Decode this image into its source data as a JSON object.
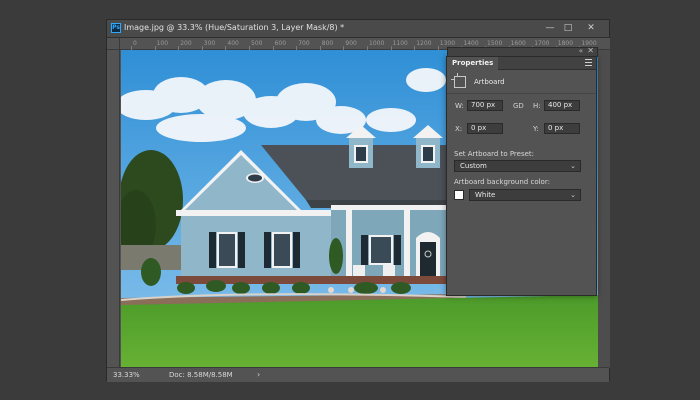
{
  "window": {
    "title": "Image.jpg @ 33.3% (Hue/Saturation 3, Layer Mask/8) *",
    "app_icon": "Ps",
    "controls": {
      "minimize": "minimize-icon",
      "restore": "restore-icon",
      "close": "close-icon"
    }
  },
  "ruler": {
    "ticks": [
      "0",
      "100",
      "200",
      "300",
      "400",
      "500",
      "600",
      "700",
      "800",
      "900",
      "1000",
      "1100",
      "1200",
      "1300",
      "1400",
      "1500",
      "1600",
      "1700",
      "1800",
      "1900",
      "2000"
    ]
  },
  "status": {
    "zoom": "33.33%",
    "doc": "Doc: 8.58M/8.58M",
    "arrow": "›"
  },
  "properties": {
    "tab": "Properties",
    "section_title": "Artboard",
    "w_label": "W:",
    "w_value": "700 px",
    "h_label": "H:",
    "h_value": "400 px",
    "x_label": "X:",
    "x_value": "0 px",
    "y_label": "Y:",
    "y_value": "0 px",
    "link_glyph": "GD",
    "preset_label": "Set Artboard to Preset:",
    "preset_value": "Custom",
    "bg_label": "Artboard background color:",
    "bg_value": "White",
    "bg_swatch": "#ffffff"
  },
  "colors": {
    "window_bg": "#535353",
    "panel_bg": "#535353",
    "sky": "#3da0dd",
    "grass": "#5aa830",
    "house_siding": "#8fb6c9",
    "roof": "#4b5157"
  }
}
